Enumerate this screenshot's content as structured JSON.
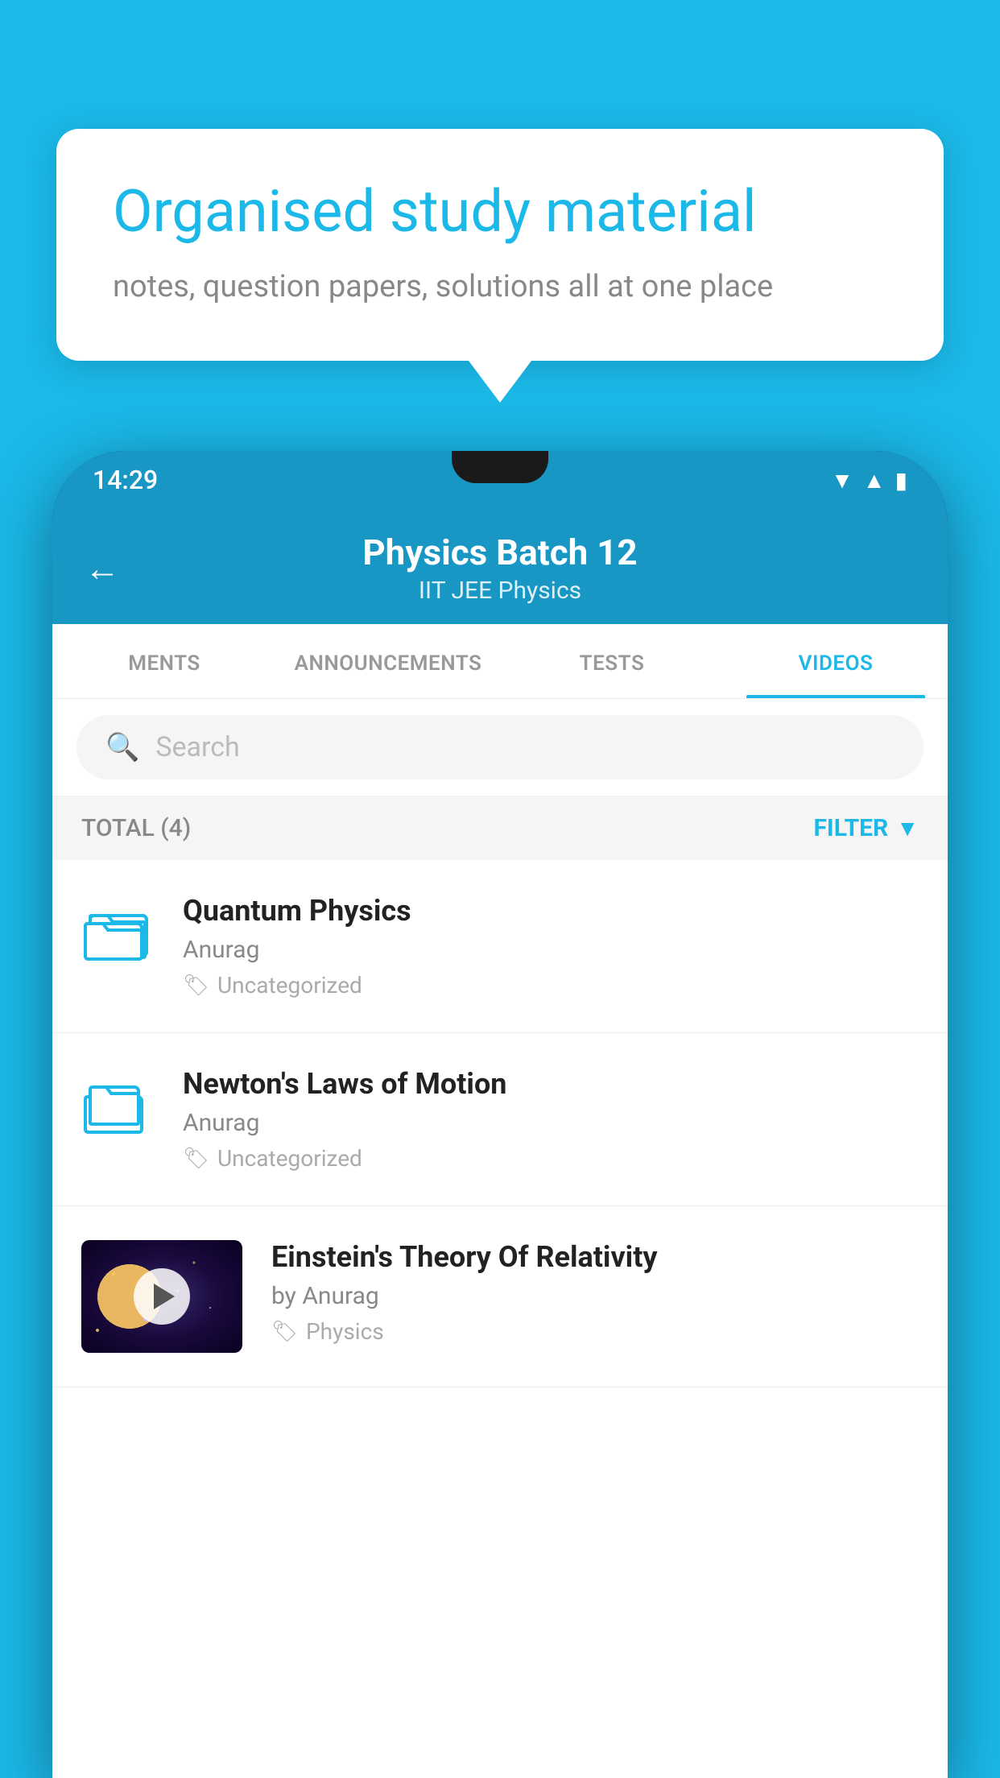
{
  "background_color": "#1BB8E8",
  "bubble": {
    "title": "Organised study material",
    "subtitle": "notes, question papers, solutions all at one place"
  },
  "status_bar": {
    "time": "14:29"
  },
  "header": {
    "title": "Physics Batch 12",
    "subtitle": "IIT JEE   Physics",
    "back_label": "←"
  },
  "tabs": [
    {
      "label": "MENTS",
      "active": false
    },
    {
      "label": "ANNOUNCEMENTS",
      "active": false
    },
    {
      "label": "TESTS",
      "active": false
    },
    {
      "label": "VIDEOS",
      "active": true
    }
  ],
  "search": {
    "placeholder": "Search"
  },
  "filter": {
    "total_label": "TOTAL (4)",
    "filter_label": "FILTER"
  },
  "videos": [
    {
      "title": "Quantum Physics",
      "author": "Anurag",
      "tag": "Uncategorized",
      "has_thumbnail": false
    },
    {
      "title": "Newton's Laws of Motion",
      "author": "Anurag",
      "tag": "Uncategorized",
      "has_thumbnail": false
    },
    {
      "title": "Einstein's Theory Of Relativity",
      "author": "by Anurag",
      "tag": "Physics",
      "has_thumbnail": true
    }
  ]
}
